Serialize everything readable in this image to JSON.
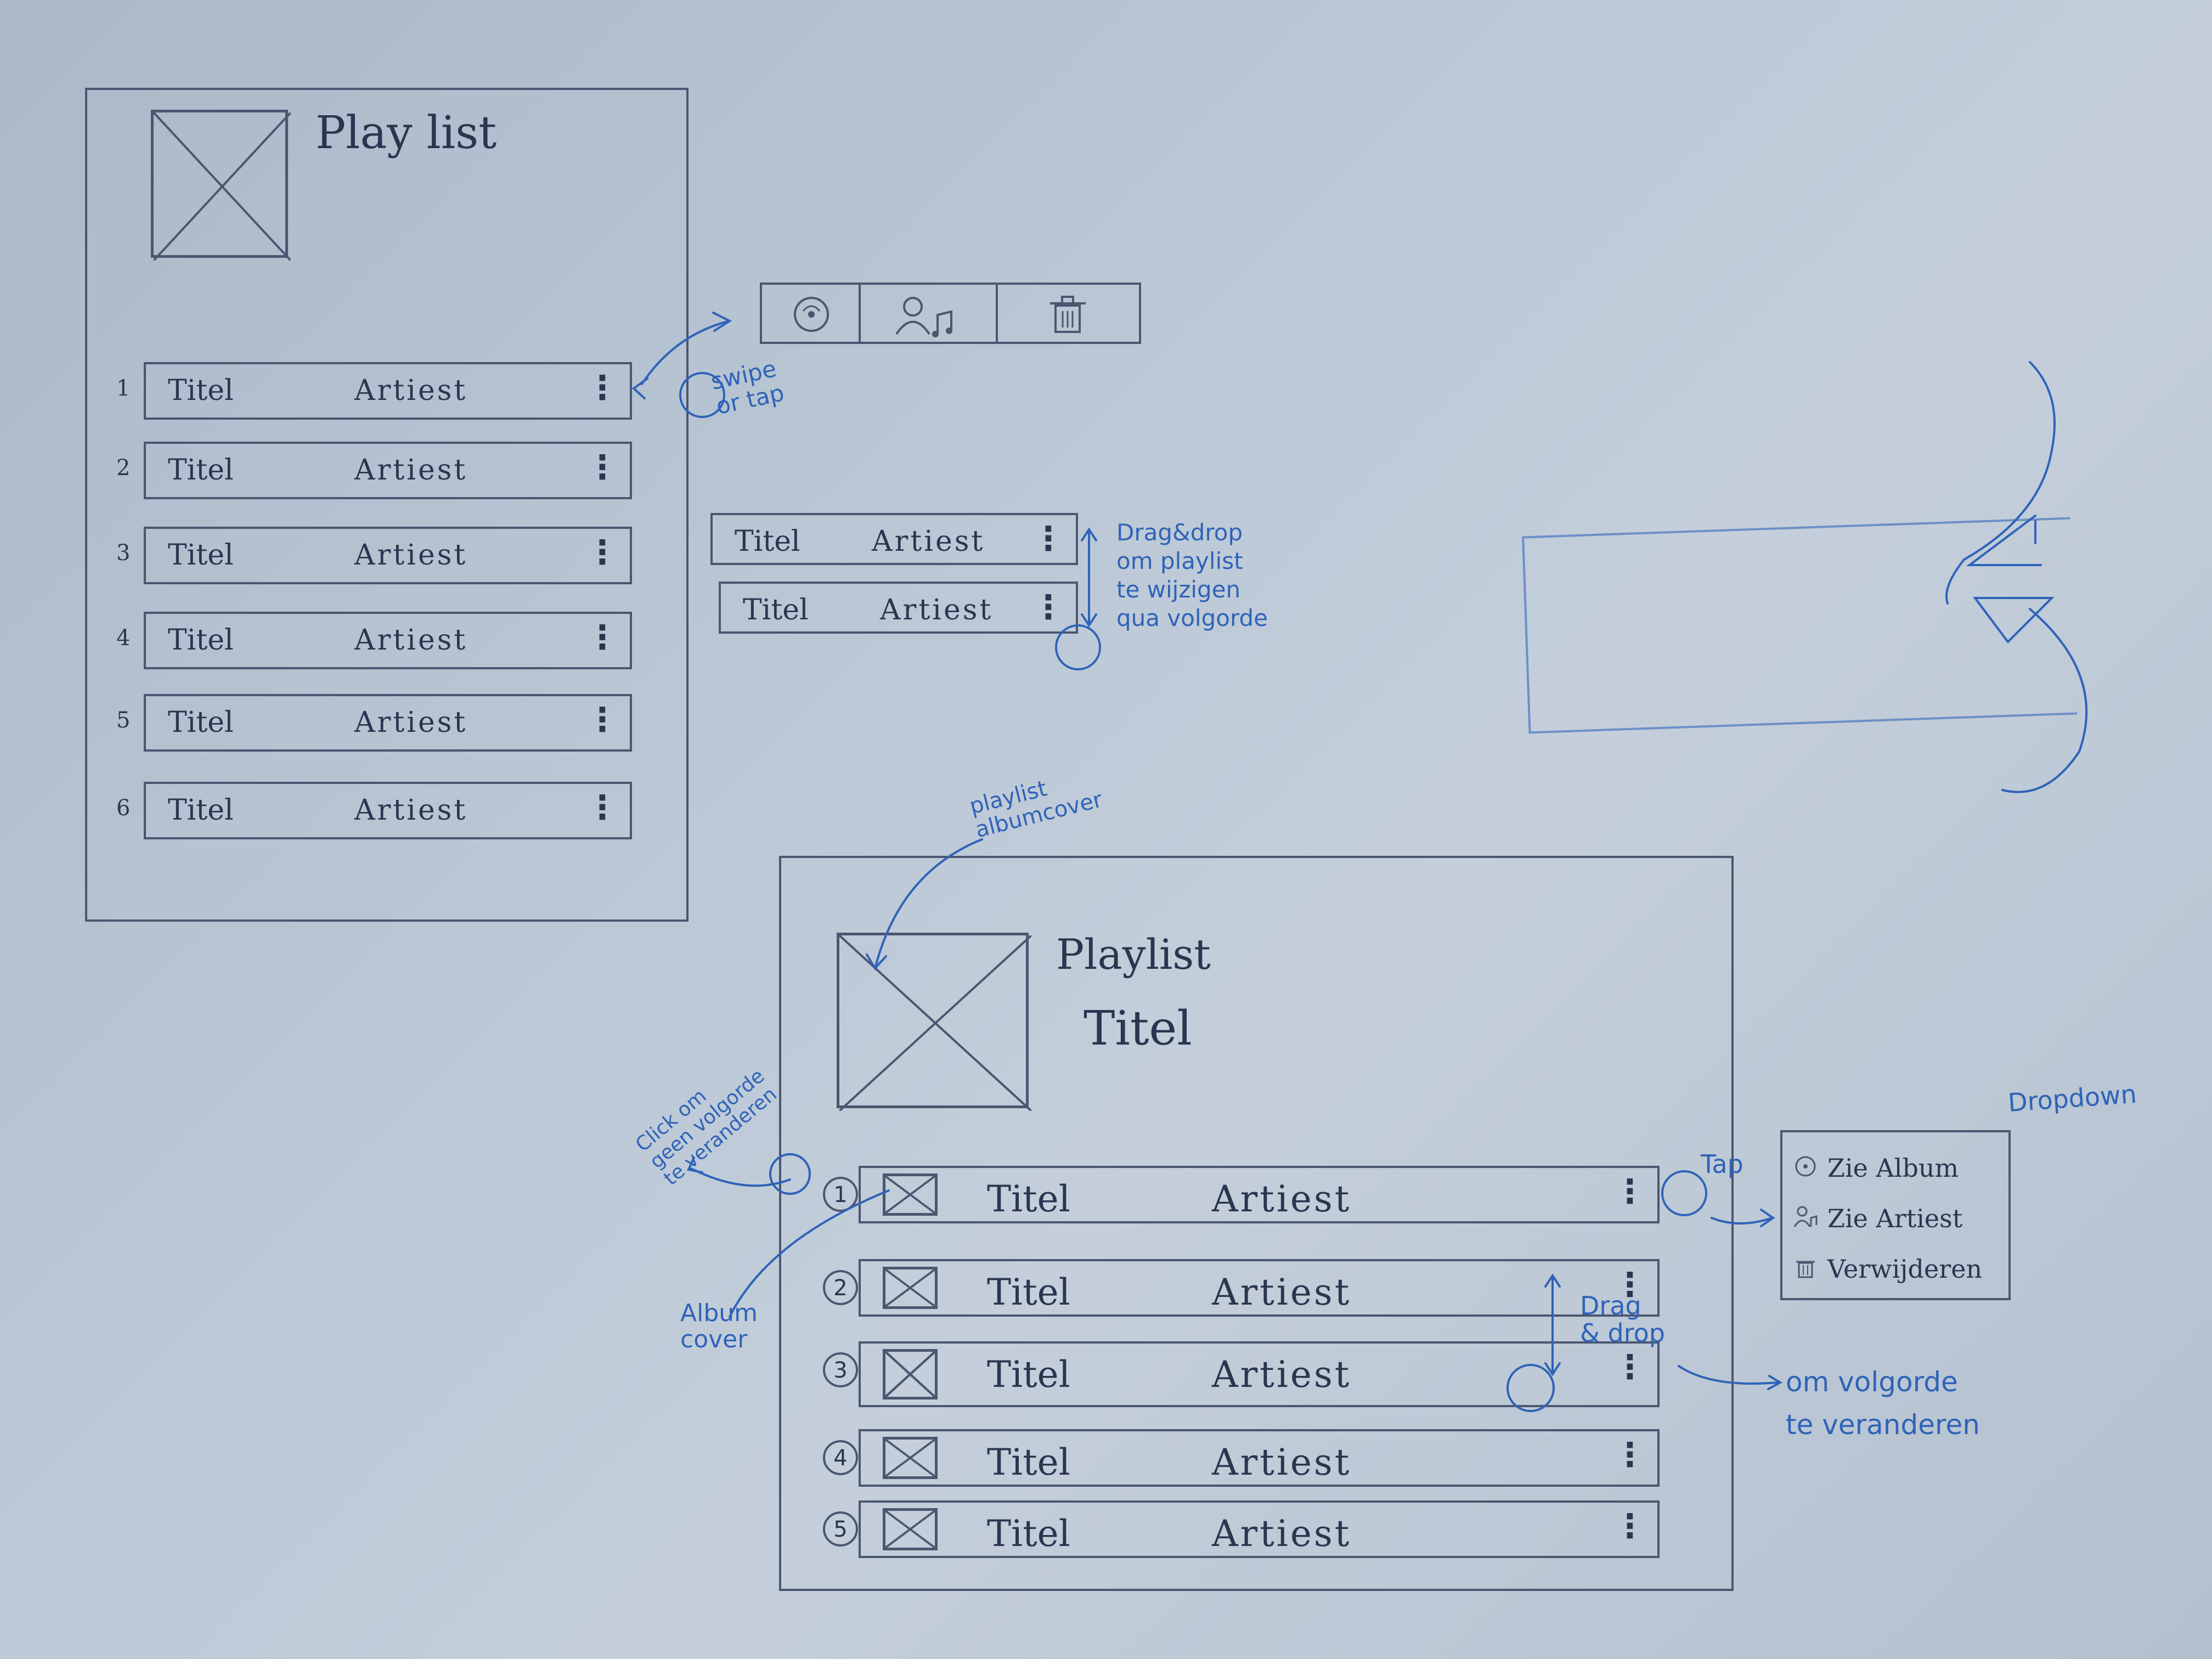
{
  "sketch1": {
    "title": "Play list",
    "rows": [
      {
        "n": "1",
        "title": "Titel",
        "artist": "Artiest",
        "menu": "⋮"
      },
      {
        "n": "2",
        "title": "Titel",
        "artist": "Artiest",
        "menu": "⋮"
      },
      {
        "n": "3",
        "title": "Titel",
        "artist": "Artiest",
        "menu": "⋮"
      },
      {
        "n": "4",
        "title": "Titel",
        "artist": "Artiest",
        "menu": "⋮"
      },
      {
        "n": "5",
        "title": "Titel",
        "artist": "Artiest",
        "menu": "⋮"
      },
      {
        "n": "6",
        "title": "Titel",
        "artist": "Artiest",
        "menu": "⋮"
      }
    ]
  },
  "action_bar": {
    "icons": [
      "album-icon",
      "artist-icon",
      "trash-icon"
    ]
  },
  "annotations": {
    "swipe": "swipe\nor tap",
    "dragdrop": "Drag&drop\nom playlist\nte wijzigen\nqua volgorde",
    "playlist_albumcover": "playlist\nalbumcover",
    "click_om": "Click om\ngeen volgorde\nte veranderen",
    "album_cover": "Album\ncover",
    "tap": "Tap",
    "drag_drop2": "Drag\n& drop",
    "om_volgorde": "om volgorde\nte veranderen",
    "dropdown": "Dropdown"
  },
  "drag_demo": {
    "rows": [
      {
        "title": "Titel",
        "artist": "Artiest",
        "menu": "⋮"
      },
      {
        "title": "Titel",
        "artist": "Artiest",
        "menu": "⋮"
      }
    ]
  },
  "sketch2": {
    "title_line1": "Playlist",
    "title_line2": "Titel",
    "rows": [
      {
        "n": "1",
        "title": "Titel",
        "artist": "Artiest",
        "menu": "⋮"
      },
      {
        "n": "2",
        "title": "Titel",
        "artist": "Artiest",
        "menu": "⋮"
      },
      {
        "n": "3",
        "title": "Titel",
        "artist": "Artiest",
        "menu": "⋮"
      },
      {
        "n": "4",
        "title": "Titel",
        "artist": "Artiest",
        "menu": "⋮"
      },
      {
        "n": "5",
        "title": "Titel",
        "artist": "Artiest",
        "menu": "⋮"
      }
    ]
  },
  "dropdown_menu": {
    "items": [
      {
        "icon": "album-icon",
        "label": "Zie Album"
      },
      {
        "icon": "artist-icon",
        "label": "Zie Artiest"
      },
      {
        "icon": "trash-icon",
        "label": "Verwijderen"
      }
    ]
  },
  "colors": {
    "pencil": "#4b5670",
    "ink": "#2f63b8",
    "paper": "#b9c6d4"
  }
}
